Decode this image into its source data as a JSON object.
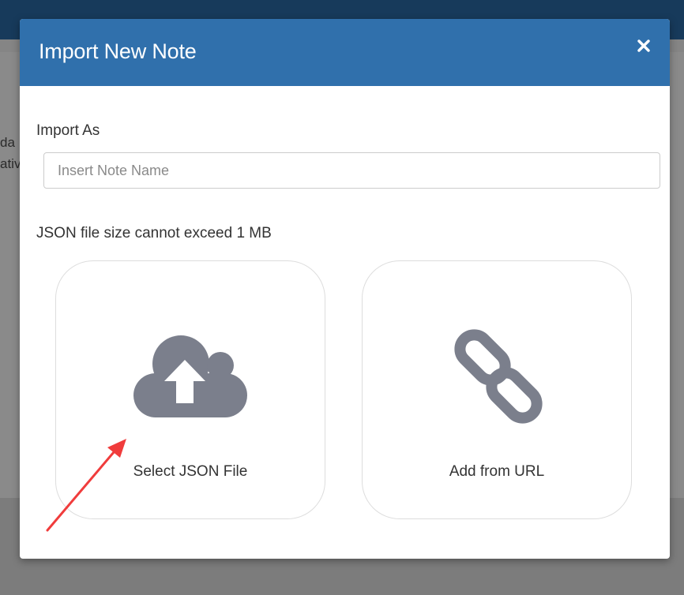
{
  "background": {
    "text_line_1": "da",
    "text_line_2": "ativ"
  },
  "modal": {
    "title": "Import New Note",
    "close_label": "×",
    "import_as_label": "Import As",
    "name_input": {
      "placeholder": "Insert Note Name",
      "value": ""
    },
    "size_note": "JSON file size cannot exceed 1 MB",
    "options": [
      {
        "label": "Select JSON File",
        "icon": "cloud-upload-icon"
      },
      {
        "label": "Add from URL",
        "icon": "link-icon"
      }
    ]
  },
  "colors": {
    "header_blue": "#3070ac",
    "icon_gray": "#7b7f8c",
    "annotation_red": "#f03c3c"
  }
}
